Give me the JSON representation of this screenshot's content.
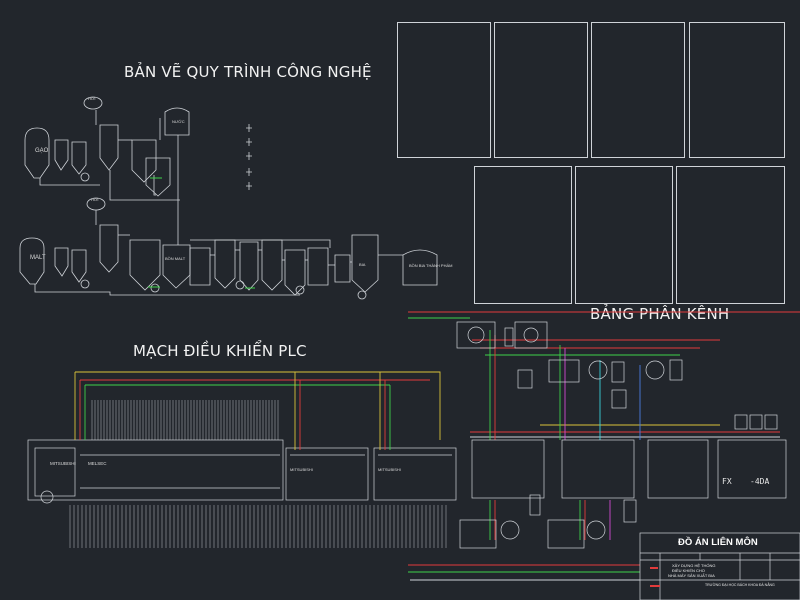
{
  "titles": {
    "process": "BẢN VẼ QUY TRÌNH CÔNG NGHỆ",
    "channels": "BẢNG PHÂN KÊNH",
    "plc": "MẠCH ĐIỀU KHIỂN PLC"
  },
  "process_labels": {
    "gao": "GẠO",
    "malt": "MALT",
    "hoi": "HƠI",
    "hoi2": "HƠI",
    "nuoc": "NƯỚC",
    "thanh_pham": "BỒN BIA THÀNH PHẨM",
    "bon_malt": "BỒN MALT",
    "bia": "BIA"
  },
  "plc_labels": {
    "main": "MITSUBISHI",
    "model": "MELSEC",
    "ext1": "MITSUBISHI",
    "ext2": "MITSUBISHI",
    "fx": "FX",
    "fx_suffix": "-4DA"
  },
  "title_block": {
    "heading": "ĐỒ ÁN LIÊN MÔN",
    "subject_line1": "XÂY DỰNG HỆ THỐNG",
    "subject_line2": "ĐIỀU KHIỂN CHO",
    "subject_line3": "NHÀ MÁY SẢN XUẤT BIA",
    "school": "TRƯỜNG ĐẠI HỌC BÁCH KHOA ĐÀ NẴNG"
  },
  "colors": {
    "background": "#22262c",
    "line": "#cfd3d8",
    "red": "#e23b3b",
    "green": "#3fd14a",
    "yellow": "#d9c23a",
    "magenta": "#d24ad2",
    "cyan": "#3ad0d9",
    "blue": "#4a7de0"
  }
}
